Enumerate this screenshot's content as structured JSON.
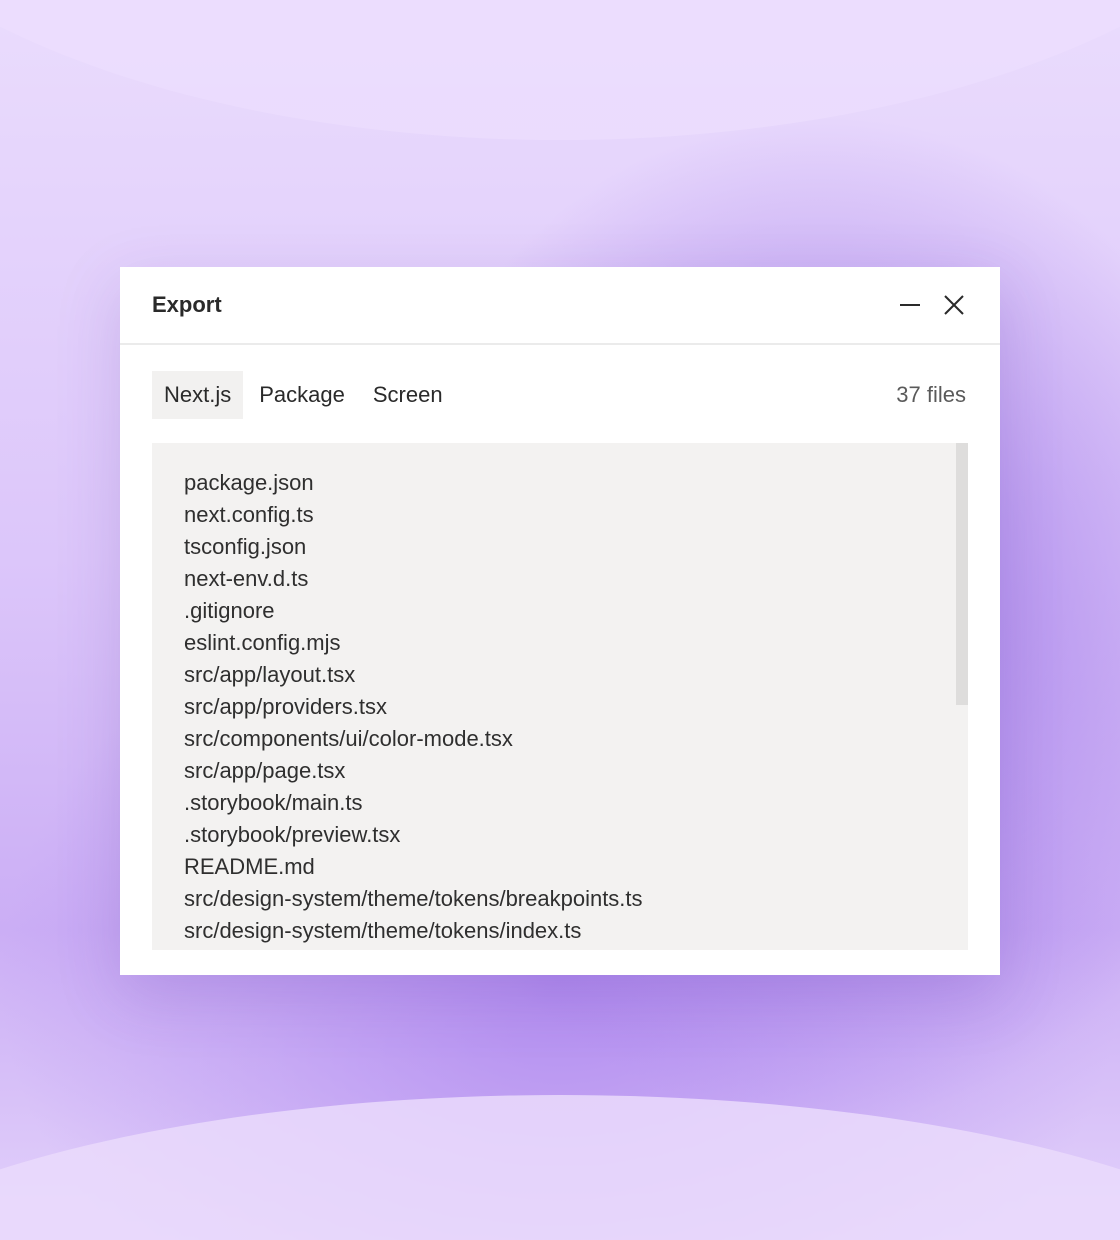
{
  "dialog": {
    "title": "Export",
    "minimize_icon": "minimize-icon",
    "close_icon": "close-icon"
  },
  "tabs": [
    {
      "label": "Next.js",
      "active": true
    },
    {
      "label": "Package",
      "active": false
    },
    {
      "label": "Screen",
      "active": false
    }
  ],
  "file_count": "37 files",
  "files": [
    "package.json",
    "next.config.ts",
    "tsconfig.json",
    "next-env.d.ts",
    ".gitignore",
    "eslint.config.mjs",
    "src/app/layout.tsx",
    "src/app/providers.tsx",
    "src/components/ui/color-mode.tsx",
    "src/app/page.tsx",
    ".storybook/main.ts",
    ".storybook/preview.tsx",
    "README.md",
    "src/design-system/theme/tokens/breakpoints.ts",
    "src/design-system/theme/tokens/index.ts"
  ],
  "colors": {
    "background_accent": "#b08cf0",
    "panel_background": "#f3f2f1",
    "active_tab_background": "#f2f1f0"
  }
}
